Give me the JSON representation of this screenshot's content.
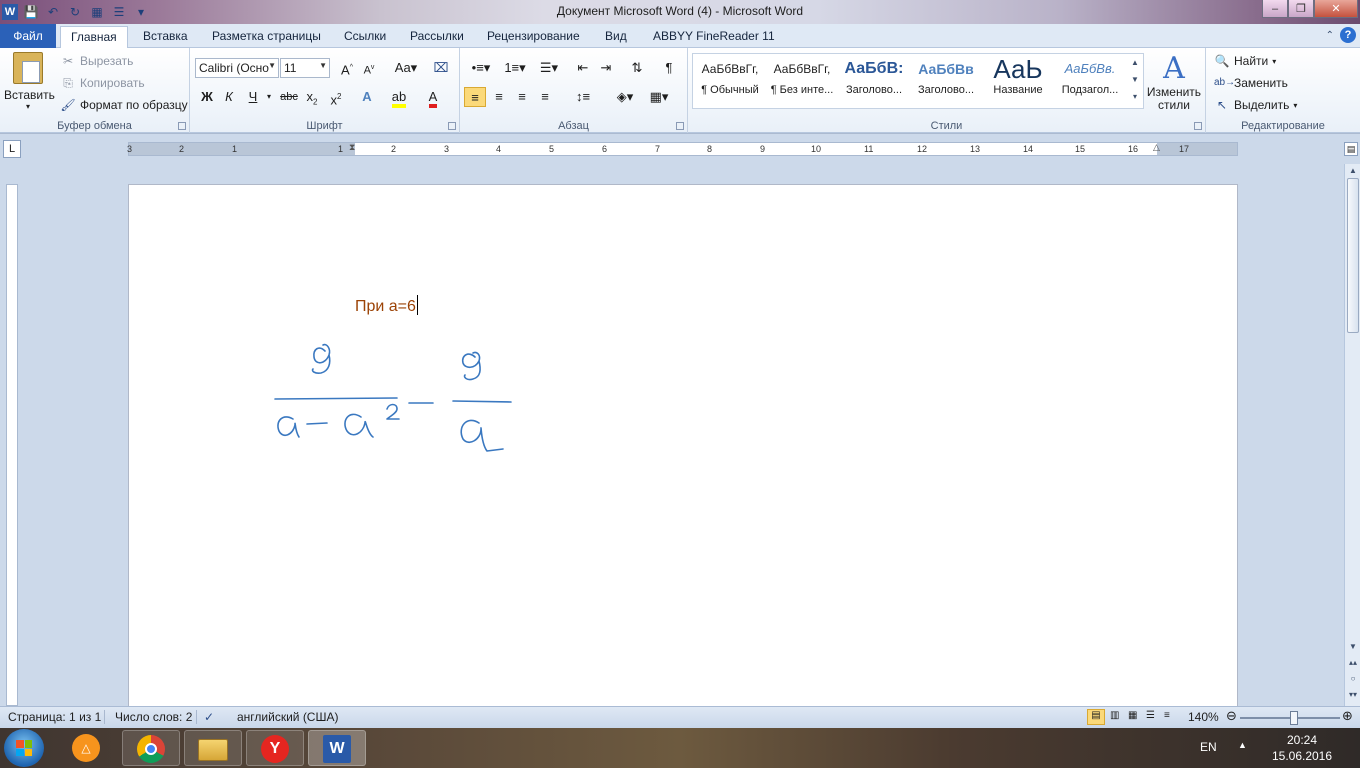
{
  "window": {
    "title": "Документ Microsoft Word (4)  -  Microsoft Word"
  },
  "tabs": {
    "file": "Файл",
    "items": [
      "Главная",
      "Вставка",
      "Разметка страницы",
      "Ссылки",
      "Рассылки",
      "Рецензирование",
      "Вид",
      "ABBYY FineReader 11"
    ]
  },
  "ribbon": {
    "clipboard": {
      "label": "Буфер обмена",
      "paste": "Вставить",
      "cut": "Вырезать",
      "copy": "Копировать",
      "format_painter": "Формат по образцу"
    },
    "font": {
      "label": "Шрифт",
      "font_name": "Calibri (Осно",
      "font_size": "11"
    },
    "paragraph": {
      "label": "Абзац"
    },
    "styles": {
      "label": "Стили",
      "items": [
        {
          "preview": "АаБбВвГг,",
          "name": "¶ Обычный",
          "color": "#000000"
        },
        {
          "preview": "АаБбВвГг,",
          "name": "¶ Без инте...",
          "color": "#000000"
        },
        {
          "preview": "АаБбВ:",
          "name": "Заголово...",
          "color": "#2b5797"
        },
        {
          "preview": "АаБбВв",
          "name": "Заголово...",
          "color": "#4f81bd"
        },
        {
          "preview": "АаЬ",
          "name": "Название",
          "color": "#17365d"
        },
        {
          "preview": "АаБбВв.",
          "name": "Подзагол...",
          "color": "#4f81bd"
        }
      ],
      "change_styles": "Изменить стили"
    },
    "editing": {
      "label": "Редактирование",
      "find": "Найти",
      "replace": "Заменить",
      "select": "Выделить"
    }
  },
  "ruler": {
    "ticks": [
      "3",
      "2",
      "1",
      "1",
      "2",
      "3",
      "4",
      "5",
      "6",
      "7",
      "8",
      "9",
      "10",
      "11",
      "12",
      "13",
      "14",
      "15",
      "16",
      "17"
    ]
  },
  "document": {
    "text": "При а=6"
  },
  "statusbar": {
    "page": "Страница: 1 из 1",
    "words": "Число слов: 2",
    "language": "английский (США)",
    "zoom": "140%"
  },
  "taskbar": {
    "lang": "EN",
    "time": "20:24",
    "date": "15.06.2016"
  }
}
